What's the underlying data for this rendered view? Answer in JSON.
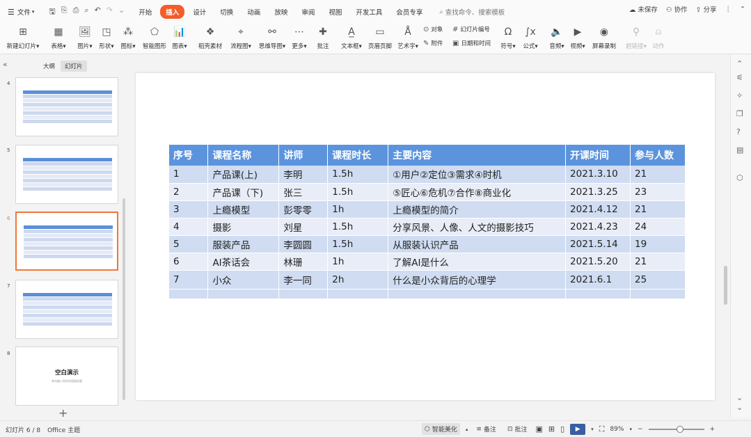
{
  "menubar": {
    "file": "文件",
    "tabs": [
      "开始",
      "插入",
      "设计",
      "切换",
      "动画",
      "放映",
      "审阅",
      "视图",
      "开发工具",
      "会员专享"
    ],
    "active_tab": "插入",
    "search_placeholder": "查找命令、搜索模板",
    "unsaved": "未保存",
    "collab": "协作",
    "share": "分享"
  },
  "ribbon": {
    "new_slide": "新建幻灯片",
    "table": "表格",
    "image": "图片",
    "shape": "形状",
    "icon": "图标",
    "smart_shape": "智能图形",
    "chart": "图表",
    "doc_material": "稻壳素材",
    "flowchart": "流程图",
    "mindmap": "思维导图",
    "more": "更多",
    "comment": "批注",
    "textbox": "文本框",
    "header_footer": "页眉页脚",
    "art_text": "艺术字",
    "object": "对象",
    "attachment": "附件",
    "slide_number": "幻灯片编号",
    "datetime": "日期和时间",
    "symbol": "符号",
    "formula": "公式",
    "audio": "音频",
    "video": "视频",
    "screen_record": "屏幕录制",
    "hyperlink": "超链接",
    "action": "动作"
  },
  "left_panel": {
    "outline_tab": "大纲",
    "slides_tab": "幻灯片",
    "slide_numbers": [
      "4",
      "5",
      "6",
      "7",
      "8"
    ],
    "blank_title": "空白演示",
    "blank_sub": "单击输入您的封面副标题"
  },
  "table": {
    "headers": [
      "序号",
      "课程名称",
      "讲师",
      "课程时长",
      "主要内容",
      "开课时间",
      "参与人数"
    ],
    "rows": [
      [
        "1",
        "产品课(上)",
        "李明",
        "1.5h",
        "①用户②定位③需求④时机",
        "2021.3.10",
        "21"
      ],
      [
        "2",
        "产品课（下)",
        "张三",
        "1.5h",
        "⑤匠心⑥危机⑦合作⑧商业化",
        "2021.3.25",
        "23"
      ],
      [
        "3",
        "上瘾模型",
        "彭零零",
        "1h",
        "上瘾模型的简介",
        "2021.4.12",
        "21"
      ],
      [
        "4",
        "摄影",
        "刘星",
        "1.5h",
        "分享风景、人像、人文的摄影技巧",
        "2021.4.23",
        "24"
      ],
      [
        "5",
        "服装产品",
        "李圆圆",
        "1.5h",
        "从服装认识产品",
        "2021.5.14",
        "19"
      ],
      [
        "6",
        "AI茶话会",
        "林珊",
        "1h",
        "了解AI是什么",
        "2021.5.20",
        "21"
      ],
      [
        "7",
        "小众",
        "李一同",
        "2h",
        "什么是小众背后的心理学",
        "2021.6.1",
        "25"
      ]
    ]
  },
  "statusbar": {
    "slide_info": "幻灯片 6 / 8",
    "theme": "Office 主题",
    "smart_beautify": "智能美化",
    "notes": "备注",
    "comments": "批注",
    "zoom": "89%"
  },
  "colors": {
    "accent": "#f35d2a",
    "header_blue": "#5b94dd",
    "row_odd": "#cfdcf1",
    "row_even": "#e8edf7"
  }
}
